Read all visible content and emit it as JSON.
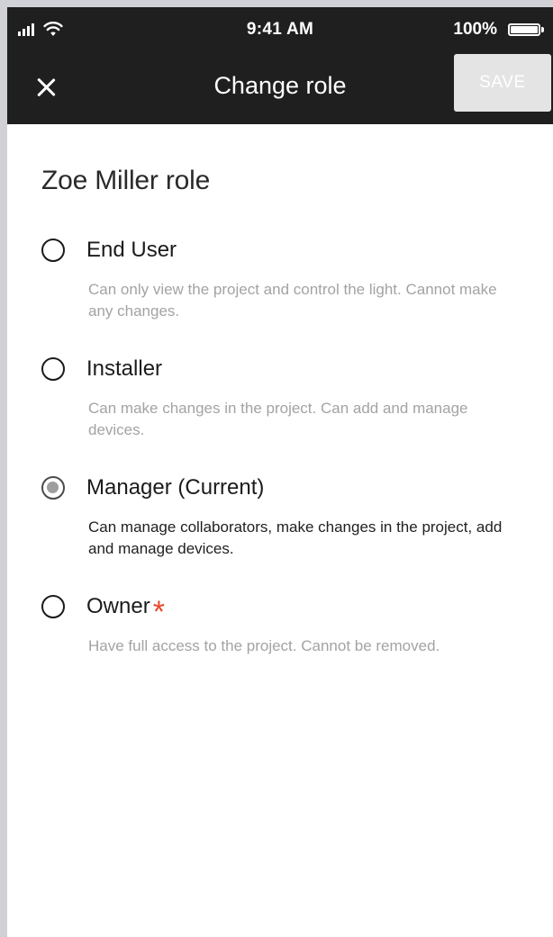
{
  "status_bar": {
    "time": "9:41 AM",
    "battery": "100%",
    "icons": [
      "signal-icon",
      "wifi-icon",
      "battery-icon"
    ]
  },
  "app_bar": {
    "title": "Change role",
    "save_label": "SAVE",
    "close_icon": "close-icon"
  },
  "section_title": "Zoe Miller role",
  "roles": [
    {
      "label": "End User",
      "description": "Can only view the project and control the light. Cannot make any changes.",
      "state": "unselected"
    },
    {
      "label": "Installer",
      "description": "Can make changes in the project. Can add and manage devices.",
      "state": "unselected"
    },
    {
      "label": "Manager (Current)",
      "description": "Can manage collaborators, make changes in the project, add and manage devices.",
      "state": "current"
    },
    {
      "label": "Owner",
      "asterisk": "*",
      "description": "Have full access to the project. Cannot be removed.",
      "state": "unselected"
    }
  ],
  "colors": {
    "app_bar": "#1f1f1f",
    "asterisk": "#e8462a",
    "muted_text": "#a3a3a3"
  }
}
